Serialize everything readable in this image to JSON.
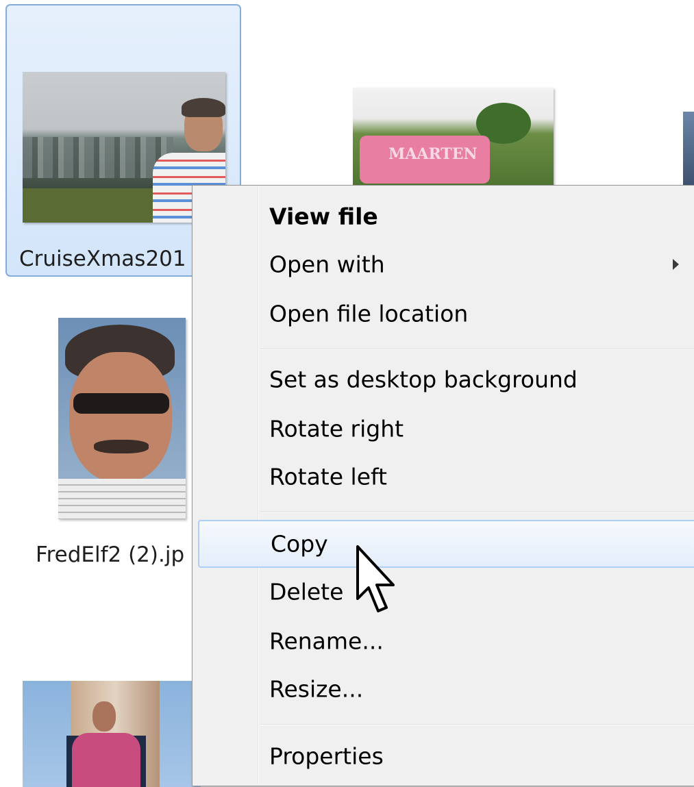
{
  "files": [
    {
      "label": "CruiseXmas201",
      "selected": true,
      "thumb_icon": "cruise-photo"
    },
    {
      "label": "",
      "selected": false,
      "thumb_icon": "maarten-sign-photo"
    },
    {
      "label": "",
      "selected": false,
      "thumb_icon": "photo-partial"
    },
    {
      "label": "FredElf2 (2).jp",
      "selected": false,
      "thumb_icon": "portrait-photo"
    },
    {
      "label": "",
      "selected": false,
      "thumb_icon": "street-photo"
    }
  ],
  "thumb_text": {
    "maarten_sign": "MAARTEN"
  },
  "context_menu": {
    "items": [
      {
        "label": "View file",
        "default": true
      },
      {
        "label": "Open with",
        "submenu": true
      },
      {
        "label": "Open file location"
      },
      {
        "label": "Set as desktop background"
      },
      {
        "label": "Rotate right"
      },
      {
        "label": "Rotate left"
      },
      {
        "label": "Copy",
        "hover": true
      },
      {
        "label": "Delete"
      },
      {
        "label": "Rename..."
      },
      {
        "label": "Resize..."
      },
      {
        "label": "Properties"
      }
    ]
  },
  "colors": {
    "selection_fill": "#d9e8fb",
    "selection_border": "#84acdd",
    "menu_background": "#f0f0f0",
    "hover_border": "#aecff7"
  },
  "cursor": {
    "icon": "arrow-pointer-icon"
  }
}
